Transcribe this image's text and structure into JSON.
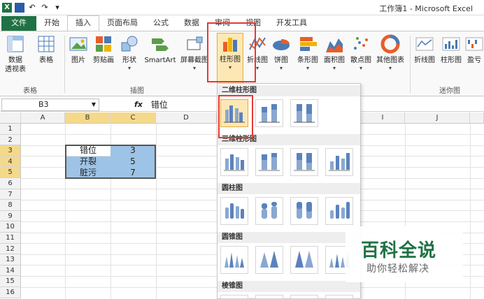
{
  "window": {
    "title": "工作簿1 - Microsoft Excel"
  },
  "tabs": [
    {
      "label": "文件"
    },
    {
      "label": "开始"
    },
    {
      "label": "插入"
    },
    {
      "label": "页面布局"
    },
    {
      "label": "公式"
    },
    {
      "label": "数据"
    },
    {
      "label": "审阅"
    },
    {
      "label": "视图"
    },
    {
      "label": "开发工具"
    }
  ],
  "ribbon": {
    "pivot": "数据",
    "pivot2": "透视表",
    "table": "表格",
    "picture": "图片",
    "clipart": "剪贴画",
    "shapes": "形状",
    "smartart": "SmartArt",
    "screenshot": "屏幕截图",
    "column": "柱形图",
    "line": "折线图",
    "pie": "饼图",
    "bar": "条形图",
    "area": "面积图",
    "scatter": "散点图",
    "other": "其他图表",
    "spark_line": "折线图",
    "spark_column": "柱形图",
    "spark_wl": "盈亏",
    "group_tables": "表格",
    "group_illustrations": "插图",
    "group_sparklines": "迷你图"
  },
  "formula": {
    "cellref": "B3",
    "fx": "fx",
    "value": "错位"
  },
  "columns": [
    "A",
    "B",
    "C",
    "D",
    "I",
    "J"
  ],
  "rows": [
    "1",
    "2",
    "3",
    "4",
    "5",
    "6",
    "7",
    "8",
    "9",
    "10",
    "11",
    "12",
    "13",
    "14",
    "15",
    "16"
  ],
  "cells": [
    {
      "b": "错位",
      "c": "3"
    },
    {
      "b": "开裂",
      "c": "5"
    },
    {
      "b": "脏污",
      "c": "7"
    }
  ],
  "dropdown": {
    "sec_2d": "二维柱形图",
    "sec_3d": "三维柱形图",
    "sec_cyl": "圆柱图",
    "sec_cone": "圆锥图",
    "sec_pyr": "棱锥图"
  },
  "watermark": {
    "title": "百科全说",
    "subtitle": "助你轻松解决"
  },
  "colors": {
    "accent": "#1f7244",
    "highlight": "#e53935",
    "selection": "#9dc3e6"
  }
}
